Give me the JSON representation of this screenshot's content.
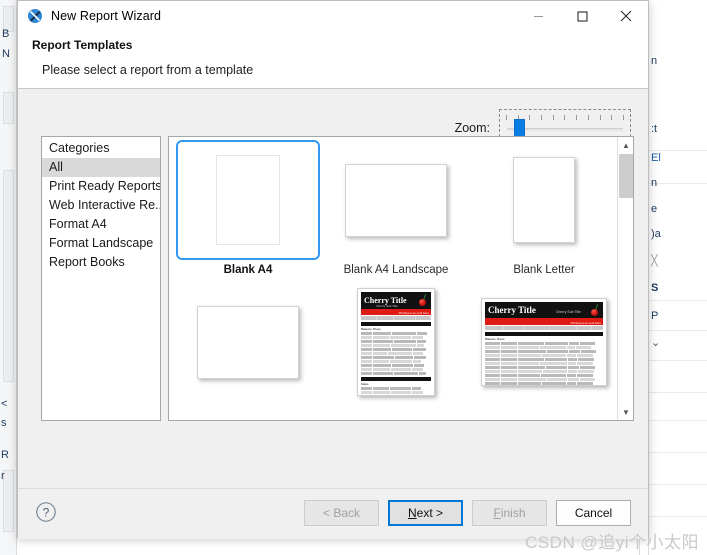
{
  "window": {
    "title": "New Report Wizard",
    "app_icon": "report-wizard-icon",
    "minimize": "minimize-icon",
    "maximize": "maximize-icon",
    "close": "close-icon"
  },
  "header": {
    "title": "Report Templates",
    "subtitle": "Please select a report from a template"
  },
  "zoom": {
    "label": "Zoom:",
    "value_percent": 12,
    "tick_count": 11
  },
  "categories": {
    "items": [
      {
        "label": "Categories",
        "selected": false
      },
      {
        "label": "All",
        "selected": true
      },
      {
        "label": "Print Ready Reports",
        "selected": false
      },
      {
        "label": "Web Interactive Re...",
        "selected": false
      },
      {
        "label": "Format A4",
        "selected": false
      },
      {
        "label": "Format Landscape",
        "selected": false
      },
      {
        "label": "Report Books",
        "selected": false
      }
    ]
  },
  "templates": {
    "row1": [
      {
        "label": "Blank A4",
        "kind": "portrait-blank",
        "selected": true
      },
      {
        "label": "Blank A4 Landscape",
        "kind": "landscape-blank",
        "selected": false
      },
      {
        "label": "Blank Letter",
        "kind": "portrait-blank",
        "selected": false
      }
    ],
    "row2": [
      {
        "label": "",
        "kind": "landscape-blank",
        "selected": false
      },
      {
        "label": "",
        "kind": "cherry-portrait",
        "selected": false
      },
      {
        "label": "",
        "kind": "cherry-landscape",
        "selected": false
      }
    ],
    "preview_text": {
      "title": "Cherry Title",
      "subtitle": "Cherry Sub Title",
      "red_note": "Printing is so cool here"
    },
    "scroll": {
      "up": "chevron-up-icon",
      "down": "chevron-down-icon"
    }
  },
  "footer": {
    "help": "?",
    "back": "< Back",
    "next_prefix": "",
    "next_key": "N",
    "next_suffix": "ext >",
    "finish_key": "F",
    "finish_rest": "inish",
    "cancel": "Cancel"
  },
  "watermark": "CSDN @追yi个小太阳",
  "background_fragments": {
    "left": [
      "B",
      "N",
      "<",
      "s",
      "R",
      "r"
    ],
    "right": [
      "n",
      "t",
      "El",
      "n",
      "e",
      "a",
      "S",
      "P"
    ]
  },
  "colors": {
    "accent": "#0078d7",
    "selection_border": "#3399f3",
    "slider_thumb": "#0a7de3",
    "report_red": "#e01b14",
    "list_selected": "#d9d9d9"
  }
}
